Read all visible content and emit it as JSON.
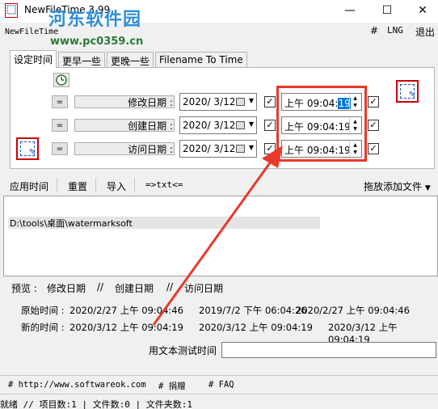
{
  "window": {
    "title": "NewFileTime 3.99",
    "subtitle": "NewFileTime",
    "watermark_logo": "河东软件园",
    "watermark_url": "www.pc0359.cn",
    "controls": {
      "minimize": "—",
      "maximize": "☐",
      "close": "✕"
    }
  },
  "menu": {
    "hash": "#",
    "lng": "LNG",
    "exit": "退出"
  },
  "tabs": [
    {
      "label": "设定时间",
      "active": true
    },
    {
      "label": "更早一些",
      "active": false
    },
    {
      "label": "更晚一些",
      "active": false
    },
    {
      "label": "Filename To Time",
      "active": false
    }
  ],
  "rows": [
    {
      "eq": "=",
      "label": "修改日期 :",
      "date": "2020/  3/12",
      "time_prefix": "上午 09:04:",
      "time_sel": "19",
      "time_suffix": "",
      "checked": true,
      "checked2": true
    },
    {
      "eq": "=",
      "label": "创建日期 :",
      "date": "2020/  3/12",
      "time_prefix": "上午 09:04:19",
      "time_sel": "",
      "time_suffix": "",
      "checked": true,
      "checked2": true
    },
    {
      "eq": "=",
      "label": "访问日期 :",
      "date": "2020/  3/12",
      "time_prefix": "上午 09:04:19",
      "time_sel": "",
      "time_suffix": "",
      "checked": true,
      "checked2": true
    }
  ],
  "check_mark": "✓",
  "toolbar": {
    "apply": "应用时间",
    "reset": "重置",
    "import": "导入",
    "txt": "=>txt<=",
    "drag_add": "拖放添加文件"
  },
  "file_list": [
    "D:\\tools\\桌面\\watermarksoft"
  ],
  "preview": {
    "label": "预览 :",
    "modify": "修改日期",
    "sep1": "//",
    "create": "创建日期",
    "sep2": "//",
    "access": "访问日期"
  },
  "original": {
    "label": "原始时间 :",
    "modify": "2020/2/27 上午 09:04:46",
    "create": "2019/7/2 下午 06:04:26",
    "access": "2020/2/27 上午 09:04:46"
  },
  "new": {
    "label": "新的时间 :",
    "modify": "2020/3/12 上午 09:04:19",
    "create": "2020/3/12 上午 09:04:19",
    "access": "2020/3/12 上午 09:04:19"
  },
  "test_label": "用文本测试时间",
  "test_value": "",
  "links": [
    "# http://www.softwareok.com",
    "# 捐赠",
    "# FAQ"
  ],
  "status": "就绪 // 项目数:1  | 文件数:0  | 文件夹数:1",
  "colors": {
    "highlight_box": "#e8392a",
    "arrow": "#e8392a",
    "selection": "#0078d7"
  }
}
